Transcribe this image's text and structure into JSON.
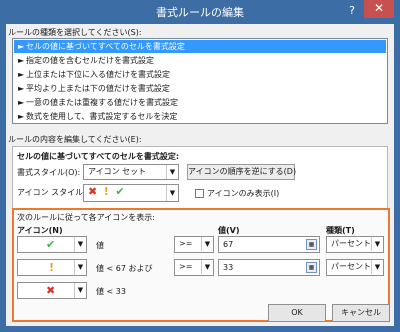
{
  "window": {
    "title": "書式ルールの編集",
    "help": "?",
    "close": "✕"
  },
  "rule_type": {
    "label": "ルールの種類を選択してください(S):",
    "items": [
      "セルの値に基づいてすべてのセルを書式設定",
      "指定の値を含むセルだけを書式設定",
      "上位または下位に入る値だけを書式設定",
      "平均より上または下の値だけを書式設定",
      "一意の値または重複する値だけを書式設定",
      "数式を使用して、書式設定するセルを決定"
    ],
    "selected_index": 0
  },
  "edit": {
    "label": "ルールの内容を編集してください(E):",
    "heading": "セルの値に基づいてすべてのセルを書式設定:",
    "format_style_label": "書式スタイル(O):",
    "format_style_value": "アイコン セット",
    "reverse_button": "アイコンの順序を逆にする(D)",
    "icon_style_label": "アイコン スタイル(C):",
    "icon_only_label": "アイコンのみ表示(I)",
    "icon_only_checked": false
  },
  "icons_rules": {
    "caption": "次のルールに従って各アイコンを表示:",
    "col_icon": "アイコン(N)",
    "col_value": "値(V)",
    "col_type": "種類(T)",
    "rows": [
      {
        "icon": "check-icon",
        "color": "#4caf50",
        "glyph": "✔",
        "desc": "値",
        "op": ">=",
        "value": "67",
        "type": "パーセント"
      },
      {
        "icon": "exclamation-icon",
        "color": "#e8a317",
        "glyph": "!",
        "desc": "値 < 67 および",
        "op": ">=",
        "value": "33",
        "type": "パーセント"
      },
      {
        "icon": "cross-icon",
        "color": "#d9362b",
        "glyph": "✖",
        "desc": "値 < 33"
      }
    ]
  },
  "footer": {
    "ok": "OK",
    "cancel": "キャンセル"
  }
}
